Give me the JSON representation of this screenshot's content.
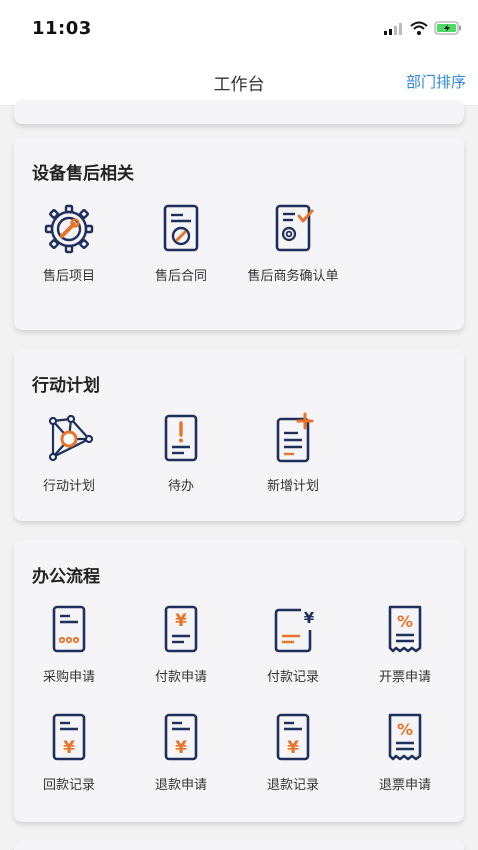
{
  "status": {
    "time": "11:03"
  },
  "nav": {
    "title": "工作台",
    "sort_label": "部门排序"
  },
  "sections": [
    {
      "title": "设备售后相关",
      "items": [
        {
          "label": "售后项目",
          "icon": "gear-wrench-icon"
        },
        {
          "label": "售后合同",
          "icon": "contract-document-icon"
        },
        {
          "label": "售后商务确认单",
          "icon": "confirm-document-icon"
        }
      ]
    },
    {
      "title": "行动计划",
      "items": [
        {
          "label": "行动计划",
          "icon": "network-icon"
        },
        {
          "label": "待办",
          "icon": "todo-document-icon"
        },
        {
          "label": "新增计划",
          "icon": "add-plan-icon"
        }
      ]
    },
    {
      "title": "办公流程",
      "items": [
        {
          "label": "采购申请",
          "icon": "purchase-document-icon"
        },
        {
          "label": "付款申请",
          "icon": "payment-document-icon"
        },
        {
          "label": "付款记录",
          "icon": "payment-record-icon"
        },
        {
          "label": "开票申请",
          "icon": "invoice-receipt-icon"
        },
        {
          "label": "回款记录",
          "icon": "refund-record-icon"
        },
        {
          "label": "退款申请",
          "icon": "refund-document-icon"
        },
        {
          "label": "退款记录",
          "icon": "refund-record-icon"
        },
        {
          "label": "退票申请",
          "icon": "invoice-receipt-icon"
        }
      ]
    }
  ],
  "colors": {
    "icon_stroke": "#1f2f5c",
    "accent": "#e8742a",
    "link": "#2f86e0"
  }
}
